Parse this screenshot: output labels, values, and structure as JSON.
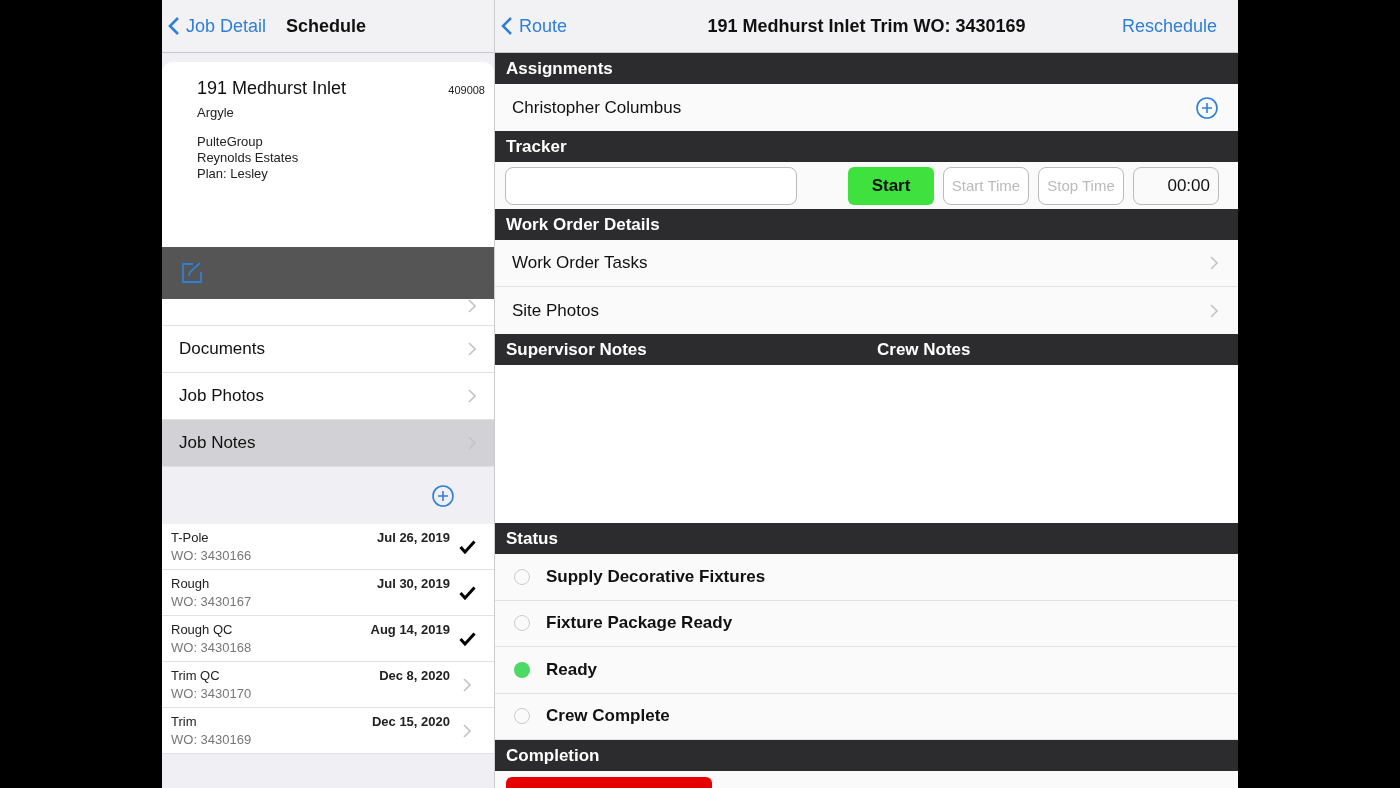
{
  "left_nav": {
    "back": "Job Detail",
    "title": "Schedule"
  },
  "job_card": {
    "address": "191 Medhurst Inlet",
    "number": "409008",
    "area": "Argyle",
    "lines": [
      "PulteGroup",
      "Reynolds Estates",
      "Plan: Lesley"
    ]
  },
  "menu_items": [
    {
      "label": "Documents",
      "selected": false
    },
    {
      "label": "Job Photos",
      "selected": false
    },
    {
      "label": "Job Notes",
      "selected": true
    }
  ],
  "work_orders": [
    {
      "name": "T-Pole",
      "wo": "WO: 3430166",
      "date": "Jul 26, 2019",
      "completed": true
    },
    {
      "name": "Rough",
      "wo": "WO: 3430167",
      "date": "Jul 30, 2019",
      "completed": true
    },
    {
      "name": "Rough QC",
      "wo": "WO: 3430168",
      "date": "Aug 14, 2019",
      "completed": true
    },
    {
      "name": "Trim QC",
      "wo": "WO: 3430170",
      "date": "Dec 8, 2020",
      "completed": false
    },
    {
      "name": "Trim",
      "wo": "WO: 3430169",
      "date": "Dec 15, 2020",
      "completed": false
    }
  ],
  "right_nav": {
    "back": "Route",
    "title": "191 Medhurst Inlet Trim WO: 3430169",
    "action": "Reschedule"
  },
  "assignments": {
    "header": "Assignments",
    "people": [
      "Christopher Columbus"
    ]
  },
  "tracker": {
    "header": "Tracker",
    "start": "Start",
    "start_time": "Start Time",
    "stop_time": "Stop Time",
    "elapsed": "00:00"
  },
  "details": {
    "header": "Work Order Details",
    "items": [
      "Work Order Tasks",
      "Site Photos"
    ]
  },
  "notes": {
    "headers": [
      "Supervisor Notes",
      "Crew Notes"
    ]
  },
  "status": {
    "header": "Status",
    "options": [
      {
        "label": "Supply Decorative Fixtures",
        "selected": false
      },
      {
        "label": "Fixture Package Ready",
        "selected": false
      },
      {
        "label": "Ready",
        "selected": true
      },
      {
        "label": "Crew Complete",
        "selected": false
      }
    ]
  },
  "completion": {
    "header": "Completion"
  }
}
